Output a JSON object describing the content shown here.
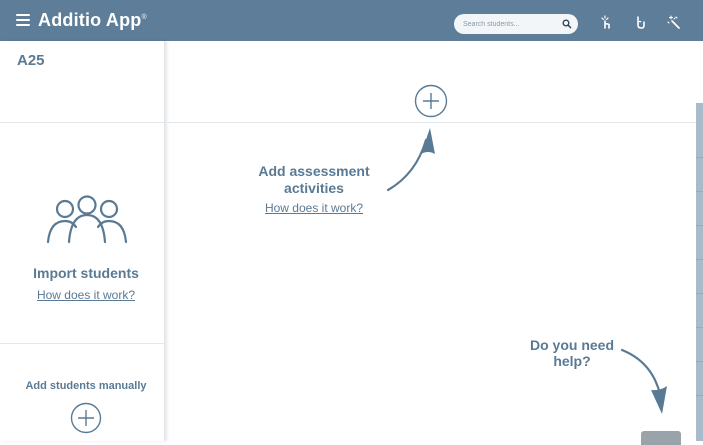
{
  "topbar": {
    "app_title": "Additio App",
    "trademark": "®",
    "search_placeholder": "Search students...",
    "icons": [
      "menu-icon",
      "search-icon",
      "touch-pointer-icon",
      "hand-raise-icon",
      "magic-wand-icon"
    ]
  },
  "sidebar": {
    "class_name": "A25",
    "import_title": "Import students",
    "import_link": "How does it work?",
    "manual_title": "Add students manually",
    "icons": [
      "students-group-icon",
      "add-circle-icon"
    ]
  },
  "main": {
    "assessment_title": "Add assessment activities",
    "assessment_link": "How does it work?",
    "help_text": "Do you need help?",
    "icons": [
      "add-circle-icon",
      "curved-arrow-icon"
    ]
  },
  "colors": {
    "topbar": "#5d7d98",
    "text": "#5a7a94",
    "background": "#ffffff",
    "side_panel": "#a9bac8"
  }
}
